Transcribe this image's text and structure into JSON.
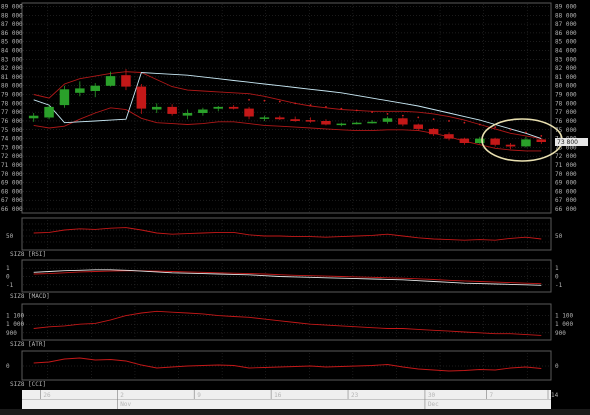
{
  "window": {
    "top_text": ""
  },
  "price_axis": {
    "ticks": [
      "89 000",
      "88 000",
      "87 000",
      "86 000",
      "85 000",
      "84 000",
      "83 000",
      "82 000",
      "81 000",
      "80 000",
      "79 000",
      "78 000",
      "77 000",
      "76 000",
      "75 000",
      "74 000",
      "73 000",
      "72 000",
      "71 000",
      "70 000",
      "69 000",
      "68 000",
      "67 000",
      "66 000"
    ],
    "last_price": "73 800"
  },
  "rsi": {
    "label": "SIZ8 [RSI]",
    "ticks": [
      "50"
    ]
  },
  "macd": {
    "label": "SIZ8 [MACD]",
    "ticks_left": [
      "1",
      "0",
      "-1"
    ],
    "ticks_right": [
      "1",
      "0",
      "-1"
    ]
  },
  "atr": {
    "label": "SIZ8 [ATR]",
    "ticks": [
      "1 100",
      "1 000",
      "900"
    ]
  },
  "cci": {
    "label": "SIZ8 [CCI]",
    "ticks": [
      "0"
    ]
  },
  "date_axis": {
    "days": [
      "26",
      "2",
      "9",
      "16",
      "23",
      "30",
      "7",
      "14"
    ],
    "months": [
      "Nov",
      "Dec"
    ]
  },
  "chart_data": {
    "type": "candlestick",
    "ylim": [
      66000,
      89000
    ],
    "candles": [
      {
        "o": 76300,
        "h": 76900,
        "l": 75900,
        "c": 76600
      },
      {
        "o": 76400,
        "h": 77800,
        "l": 76200,
        "c": 77600
      },
      {
        "o": 77800,
        "h": 80000,
        "l": 77500,
        "c": 79600
      },
      {
        "o": 79200,
        "h": 80500,
        "l": 78800,
        "c": 79700
      },
      {
        "o": 79400,
        "h": 80300,
        "l": 78700,
        "c": 80000
      },
      {
        "o": 80000,
        "h": 81600,
        "l": 79900,
        "c": 81100
      },
      {
        "o": 81200,
        "h": 81900,
        "l": 79500,
        "c": 79900
      },
      {
        "o": 79900,
        "h": 80200,
        "l": 76800,
        "c": 77400
      },
      {
        "o": 77300,
        "h": 78000,
        "l": 76900,
        "c": 77600
      },
      {
        "o": 77600,
        "h": 77900,
        "l": 76600,
        "c": 76800
      },
      {
        "o": 76600,
        "h": 77300,
        "l": 76200,
        "c": 76900
      },
      {
        "o": 76900,
        "h": 77500,
        "l": 76600,
        "c": 77300
      },
      {
        "o": 77400,
        "h": 77700,
        "l": 77100,
        "c": 77600
      },
      {
        "o": 77600,
        "h": 77800,
        "l": 77300,
        "c": 77400
      },
      {
        "o": 77400,
        "h": 77600,
        "l": 76200,
        "c": 76500
      },
      {
        "o": 76300,
        "h": 76600,
        "l": 76000,
        "c": 76400
      },
      {
        "o": 76400,
        "h": 76600,
        "l": 76100,
        "c": 76200
      },
      {
        "o": 76200,
        "h": 76500,
        "l": 75900,
        "c": 76000
      },
      {
        "o": 76100,
        "h": 76400,
        "l": 75800,
        "c": 76000
      },
      {
        "o": 76000,
        "h": 76200,
        "l": 75500,
        "c": 75600
      },
      {
        "o": 75600,
        "h": 75800,
        "l": 75400,
        "c": 75700
      },
      {
        "o": 75700,
        "h": 75900,
        "l": 75600,
        "c": 75800
      },
      {
        "o": 75800,
        "h": 76100,
        "l": 75700,
        "c": 75900
      },
      {
        "o": 75900,
        "h": 76500,
        "l": 75700,
        "c": 76300
      },
      {
        "o": 76300,
        "h": 76400,
        "l": 75400,
        "c": 75600
      },
      {
        "o": 75600,
        "h": 75700,
        "l": 74900,
        "c": 75100
      },
      {
        "o": 75100,
        "h": 75200,
        "l": 74300,
        "c": 74500
      },
      {
        "o": 74500,
        "h": 74700,
        "l": 73800,
        "c": 74000
      },
      {
        "o": 74000,
        "h": 74100,
        "l": 73300,
        "c": 73500
      },
      {
        "o": 73500,
        "h": 74200,
        "l": 73400,
        "c": 74000
      },
      {
        "o": 74000,
        "h": 74100,
        "l": 73100,
        "c": 73300
      },
      {
        "o": 73300,
        "h": 73500,
        "l": 72800,
        "c": 73100
      },
      {
        "o": 73100,
        "h": 74200,
        "l": 73000,
        "c": 73900
      },
      {
        "o": 73900,
        "h": 74000,
        "l": 73400,
        "c": 73600
      }
    ],
    "moving_average": [
      78400,
      77800,
      75800,
      75900,
      76000,
      76100,
      76200,
      81500,
      81400,
      81300,
      81200,
      81000,
      80800,
      80600,
      80400,
      80200,
      80000,
      79800,
      79600,
      79400,
      79200,
      78900,
      78600,
      78300,
      78000,
      77700,
      77300,
      76900,
      76500,
      76100,
      75600,
      75100,
      74600,
      74000
    ],
    "channel_upper": [
      79000,
      78600,
      80200,
      80800,
      81100,
      81400,
      81600,
      81500,
      80700,
      79900,
      79500,
      79400,
      79300,
      79200,
      79100,
      78800,
      78400,
      78000,
      77700,
      77500,
      77300,
      77200,
      77100,
      77100,
      77100,
      77000,
      76800,
      76500,
      76100,
      75600,
      75100,
      74600,
      74300,
      74000
    ],
    "channel_lower": [
      75500,
      75200,
      75400,
      76200,
      76900,
      77500,
      77300,
      76300,
      75800,
      75700,
      75600,
      75700,
      75900,
      75900,
      75700,
      75500,
      75400,
      75300,
      75200,
      75100,
      75000,
      74900,
      74900,
      75000,
      75000,
      74900,
      74600,
      74200,
      73700,
      73300,
      72900,
      72700,
      72600,
      72600
    ],
    "sar": [
      null,
      null,
      null,
      null,
      null,
      null,
      null,
      null,
      null,
      null,
      null,
      null,
      null,
      null,
      78400,
      78300,
      78200,
      78000,
      77800,
      77600,
      77400,
      77200,
      77000,
      76800,
      76600,
      76400,
      76200,
      76000,
      75800,
      75600,
      75300,
      75000,
      74700,
      74300
    ],
    "rsi": [
      55,
      56,
      60,
      62,
      61,
      63,
      64,
      60,
      55,
      53,
      54,
      55,
      56,
      56,
      52,
      50,
      50,
      49,
      49,
      48,
      49,
      50,
      51,
      53,
      50,
      47,
      45,
      44,
      43,
      44,
      43,
      46,
      48,
      45
    ],
    "macd": [
      0.5,
      0.6,
      0.7,
      0.75,
      0.8,
      0.8,
      0.75,
      0.65,
      0.55,
      0.45,
      0.4,
      0.35,
      0.3,
      0.25,
      0.2,
      0.1,
      0.0,
      -0.05,
      -0.1,
      -0.15,
      -0.2,
      -0.25,
      -0.3,
      -0.35,
      -0.4,
      -0.5,
      -0.6,
      -0.7,
      -0.8,
      -0.85,
      -0.9,
      -0.95,
      -1.0,
      -1.05
    ],
    "macd_signal": [
      0.3,
      0.35,
      0.45,
      0.55,
      0.6,
      0.65,
      0.68,
      0.68,
      0.65,
      0.6,
      0.55,
      0.5,
      0.45,
      0.4,
      0.35,
      0.3,
      0.22,
      0.15,
      0.1,
      0.05,
      0.0,
      -0.05,
      -0.1,
      -0.15,
      -0.2,
      -0.28,
      -0.36,
      -0.45,
      -0.53,
      -0.6,
      -0.67,
      -0.73,
      -0.8,
      -0.86
    ],
    "atr": [
      950,
      970,
      980,
      1000,
      1010,
      1050,
      1100,
      1130,
      1150,
      1140,
      1130,
      1120,
      1100,
      1090,
      1080,
      1060,
      1040,
      1020,
      1000,
      990,
      980,
      970,
      960,
      950,
      950,
      940,
      930,
      920,
      910,
      900,
      890,
      890,
      880,
      870
    ],
    "cci": [
      30,
      40,
      70,
      80,
      60,
      65,
      50,
      10,
      -20,
      -10,
      0,
      5,
      10,
      5,
      -20,
      -15,
      -10,
      -5,
      0,
      -10,
      -5,
      0,
      5,
      15,
      -10,
      -30,
      -40,
      -50,
      -45,
      -35,
      -40,
      -20,
      -10,
      -25
    ]
  }
}
